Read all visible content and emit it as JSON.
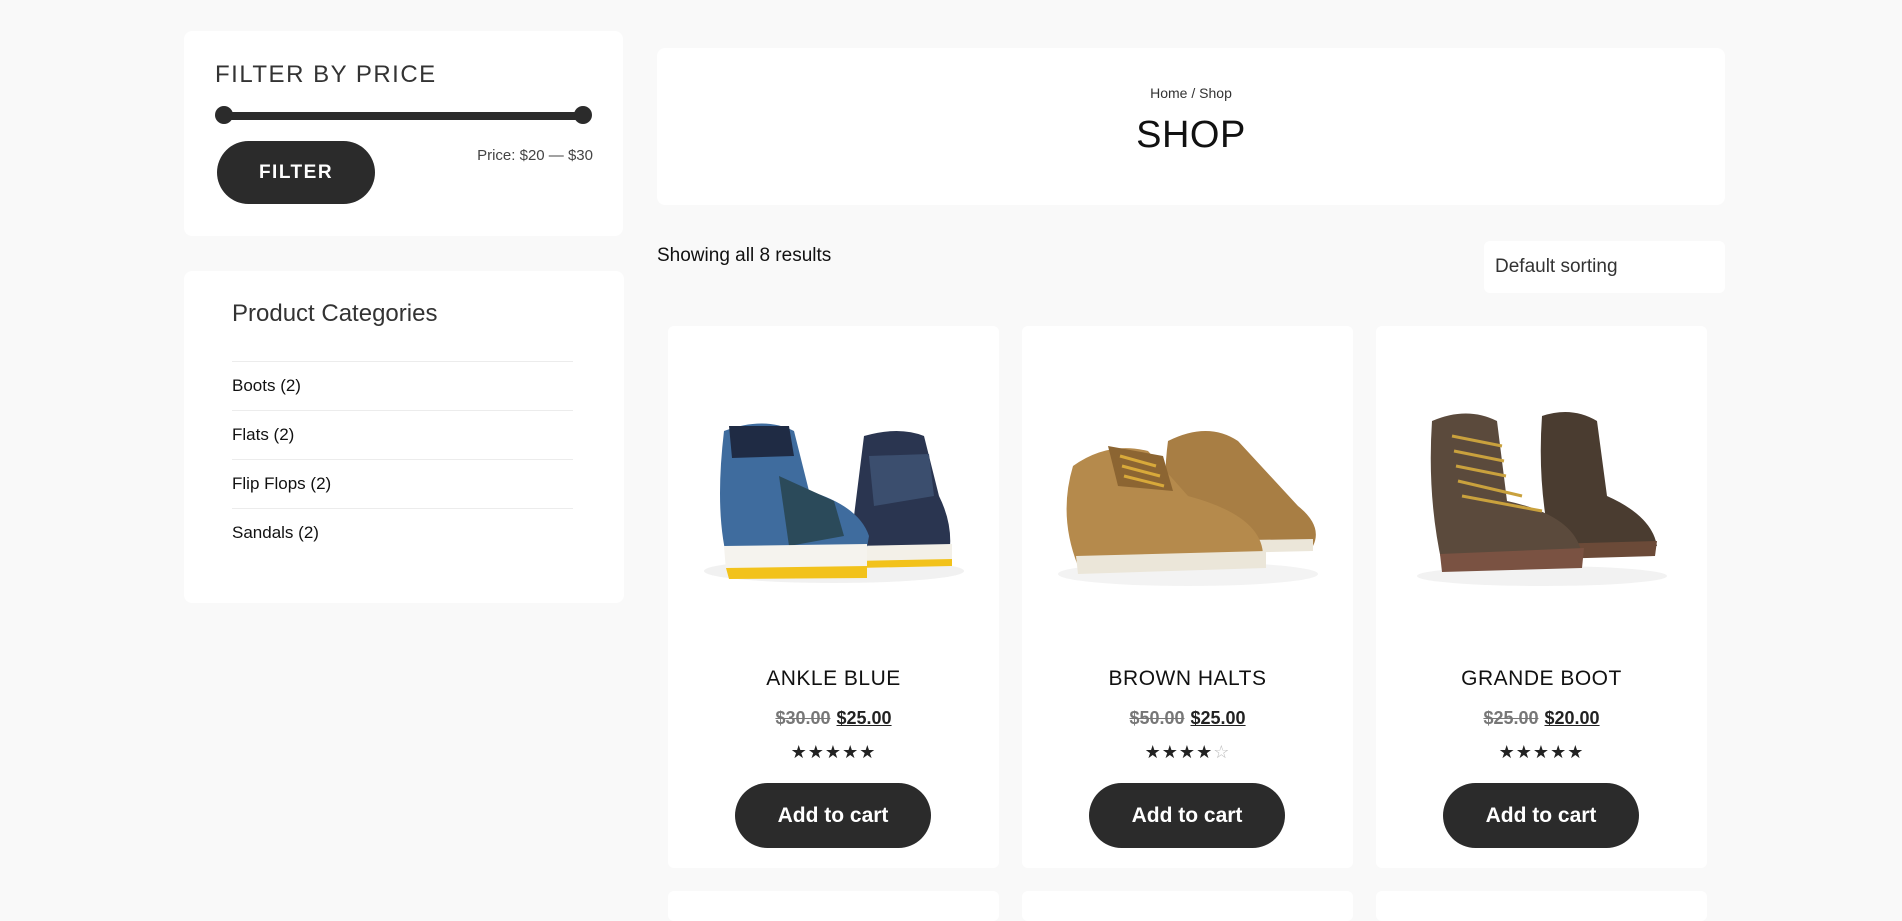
{
  "price_filter": {
    "title": "FILTER BY PRICE",
    "button_label": "FILTER",
    "price_label": "Price: $20 — $30",
    "min_value": 20,
    "max_value": 30
  },
  "categories": {
    "title": "Product Categories",
    "items": [
      {
        "label": "Boots (2)"
      },
      {
        "label": "Flats (2)"
      },
      {
        "label": "Flip Flops (2)"
      },
      {
        "label": "Sandals (2)"
      }
    ]
  },
  "header": {
    "breadcrumb_home": "Home",
    "breadcrumb_sep": "/",
    "breadcrumb_current": "Shop",
    "title": "SHOP"
  },
  "results_text": "Showing all 8 results",
  "sorting": {
    "selected": "Default sorting"
  },
  "products": [
    {
      "name": "ANKLE BLUE",
      "old_price": "$30.00",
      "price": "$25.00",
      "rating": 5,
      "stars": "★★★★★",
      "empty_stars": "",
      "button": "Add to cart"
    },
    {
      "name": "BROWN HALTS",
      "old_price": "$50.00",
      "price": "$25.00",
      "rating": 4,
      "stars": "★★★★",
      "empty_stars": "☆",
      "button": "Add to cart"
    },
    {
      "name": "GRANDE BOOT",
      "old_price": "$25.00",
      "price": "$20.00",
      "rating": 5,
      "stars": "★★★★★",
      "empty_stars": "",
      "button": "Add to cart"
    }
  ],
  "colors": {
    "background": "#f9f9f9",
    "button": "#2b2b2b",
    "blue_shoe": "#3f6c9e",
    "brown_shoe": "#b58a4c",
    "boot": "#5b4a3c"
  }
}
